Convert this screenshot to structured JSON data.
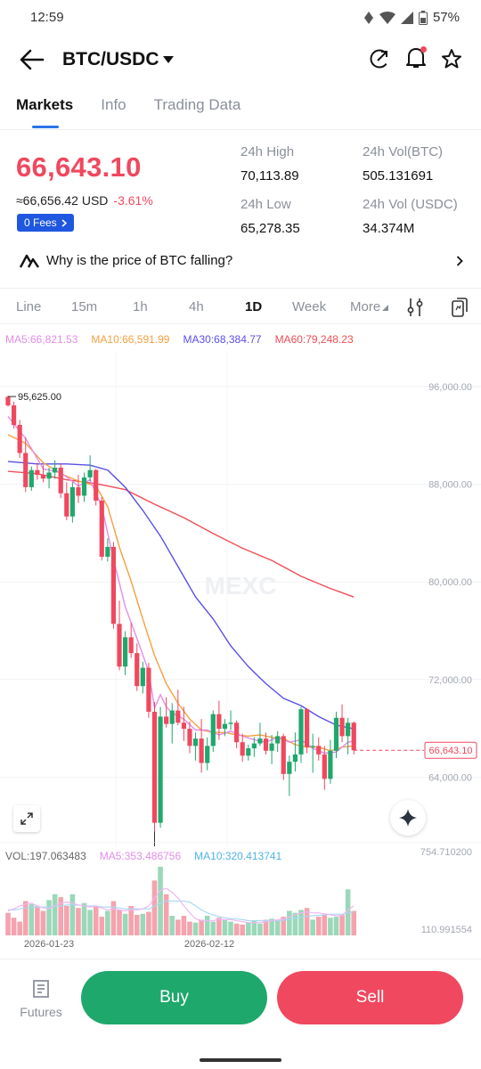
{
  "status": {
    "time": "12:59",
    "battery": "57%"
  },
  "header": {
    "pair": "BTC/USDC"
  },
  "tabs": [
    {
      "label": "Markets"
    },
    {
      "label": "Info"
    },
    {
      "label": "Trading Data"
    }
  ],
  "ticker": {
    "price": "66,643.10",
    "usd_equiv": "≈66,656.42 USD",
    "change": "-3.61%",
    "fees_badge": "0 Fees",
    "high_label": "24h High",
    "high_value": "70,113.89",
    "low_label": "24h Low",
    "low_value": "65,278.35",
    "vol_btc_label": "24h Vol(BTC)",
    "vol_btc_value": "505.131691",
    "vol_usdc_label": "24h Vol (USDC)",
    "vol_usdc_value": "34.374M"
  },
  "insight": {
    "text": "Why is the price of BTC falling?"
  },
  "intervals": [
    {
      "label": "Line"
    },
    {
      "label": "15m"
    },
    {
      "label": "1h"
    },
    {
      "label": "4h"
    },
    {
      "label": "1D",
      "active": true
    },
    {
      "label": "Week"
    },
    {
      "label": "More"
    }
  ],
  "ma": {
    "ma5": "MA5:66,821.53",
    "ma10": "MA10:66,591.99",
    "ma30": "MA30:68,384.77",
    "ma60": "MA60:79,248.23"
  },
  "colors": {
    "up": "#1fa86c",
    "down": "#f0485f",
    "ma5": "#e38ce8",
    "ma10": "#f5a041",
    "ma30": "#5b4fe8",
    "ma60": "#ef4d55",
    "accent": "#2a73e8"
  },
  "watermark": "MEXC",
  "chart_data": {
    "type": "candlestick",
    "interval": "1D",
    "ylim": [
      58000,
      98000
    ],
    "y_ticks": [
      "96,000.00",
      "88,000.00",
      "80,000.00",
      "72,000.00",
      "64,000.00"
    ],
    "last_price_label": "66,643.10",
    "high_marker": "95,625.00",
    "low_marker": "60,000.00",
    "x_labels": [
      "2026-01-23",
      "2026-02-12"
    ],
    "candles": [
      [
        95600,
        95700,
        94800,
        94900
      ],
      [
        94900,
        95200,
        93000,
        93300
      ],
      [
        93300,
        93700,
        90600,
        91000
      ],
      [
        91000,
        92300,
        87800,
        88200
      ],
      [
        88200,
        89900,
        87900,
        89600
      ],
      [
        89600,
        90200,
        88800,
        89200
      ],
      [
        89200,
        90000,
        88600,
        88900
      ],
      [
        88900,
        89800,
        88100,
        89400
      ],
      [
        89400,
        90400,
        88900,
        89800
      ],
      [
        89800,
        90100,
        87300,
        87700
      ],
      [
        87700,
        88600,
        85500,
        85800
      ],
      [
        85800,
        88600,
        85300,
        88200
      ],
      [
        88200,
        89200,
        86900,
        87500
      ],
      [
        87500,
        89400,
        87000,
        89000
      ],
      [
        89000,
        90800,
        88700,
        89600
      ],
      [
        89600,
        89700,
        86700,
        87100
      ],
      [
        87100,
        87400,
        82200,
        82500
      ],
      [
        82500,
        84000,
        82100,
        83300
      ],
      [
        83300,
        83700,
        76600,
        77000
      ],
      [
        77000,
        78900,
        73200,
        73500
      ],
      [
        73500,
        76400,
        72800,
        75900
      ],
      [
        75900,
        77100,
        74200,
        74600
      ],
      [
        74600,
        75400,
        71500,
        71900
      ],
      [
        71900,
        73900,
        71300,
        73400
      ],
      [
        73400,
        73800,
        69300,
        69800
      ],
      [
        69800,
        70600,
        60000,
        60700
      ],
      [
        60700,
        70200,
        60300,
        69400
      ],
      [
        69400,
        71000,
        68500,
        68800
      ],
      [
        68800,
        70500,
        67200,
        69900
      ],
      [
        69900,
        71600,
        68700,
        68900
      ],
      [
        68900,
        70200,
        67400,
        68400
      ],
      [
        68400,
        69000,
        66400,
        67000
      ],
      [
        67000,
        68100,
        65800,
        67600
      ],
      [
        67600,
        69200,
        64800,
        65600
      ],
      [
        65600,
        67700,
        65000,
        67000
      ],
      [
        67000,
        69900,
        66500,
        69600
      ],
      [
        69600,
        70700,
        67500,
        68400
      ],
      [
        68400,
        69200,
        67800,
        68800
      ],
      [
        68800,
        69900,
        68300,
        68900
      ],
      [
        68900,
        69100,
        66800,
        67300
      ],
      [
        67300,
        68000,
        65700,
        66200
      ],
      [
        66200,
        67100,
        65800,
        66800
      ],
      [
        66800,
        67700,
        66100,
        67200
      ],
      [
        67200,
        68900,
        67000,
        67600
      ],
      [
        67600,
        68100,
        66300,
        66600
      ],
      [
        66600,
        67900,
        65500,
        67200
      ],
      [
        67200,
        68200,
        66500,
        67800
      ],
      [
        67800,
        68000,
        64200,
        64700
      ],
      [
        64700,
        66200,
        62900,
        65700
      ],
      [
        65700,
        68100,
        64900,
        66300
      ],
      [
        66300,
        70200,
        65600,
        70000
      ],
      [
        70000,
        70100,
        66400,
        66900
      ],
      [
        66900,
        68000,
        64800,
        67000
      ],
      [
        67000,
        67700,
        65800,
        66300
      ],
      [
        66300,
        67000,
        63400,
        64300
      ],
      [
        64300,
        67500,
        63900,
        66600
      ],
      [
        66600,
        69800,
        66000,
        69300
      ],
      [
        69300,
        70400,
        67300,
        67800
      ],
      [
        67800,
        69300,
        66300,
        68900
      ],
      [
        68900,
        69000,
        66300,
        66643.1
      ]
    ],
    "ma5_points": [
      [
        0,
        94000
      ],
      [
        3,
        92200
      ],
      [
        6,
        89700
      ],
      [
        9,
        89400
      ],
      [
        12,
        88300
      ],
      [
        14,
        88800
      ],
      [
        16,
        86600
      ],
      [
        18,
        82300
      ],
      [
        20,
        78400
      ],
      [
        22,
        75800
      ],
      [
        24,
        73100
      ],
      [
        25,
        70100
      ],
      [
        26,
        71200
      ],
      [
        27,
        70200
      ],
      [
        28,
        69700
      ],
      [
        30,
        69200
      ],
      [
        32,
        68300
      ],
      [
        34,
        68300
      ],
      [
        36,
        67900
      ],
      [
        38,
        68200
      ],
      [
        40,
        67800
      ],
      [
        42,
        67500
      ],
      [
        44,
        67300
      ],
      [
        46,
        67700
      ],
      [
        48,
        67300
      ],
      [
        50,
        67500
      ],
      [
        52,
        66800
      ],
      [
        54,
        66400
      ],
      [
        56,
        66500
      ],
      [
        58,
        67300
      ],
      [
        59,
        67400
      ]
    ],
    "ma10_points": [
      [
        0,
        92500
      ],
      [
        3,
        91800
      ],
      [
        6,
        90200
      ],
      [
        9,
        89300
      ],
      [
        12,
        88700
      ],
      [
        15,
        88300
      ],
      [
        17,
        86600
      ],
      [
        19,
        83300
      ],
      [
        21,
        80500
      ],
      [
        23,
        77400
      ],
      [
        25,
        74400
      ],
      [
        27,
        72100
      ],
      [
        29,
        70500
      ],
      [
        31,
        69200
      ],
      [
        33,
        68300
      ],
      [
        35,
        68100
      ],
      [
        37,
        68100
      ],
      [
        39,
        67900
      ],
      [
        41,
        67800
      ],
      [
        43,
        67900
      ],
      [
        45,
        67700
      ],
      [
        47,
        67600
      ],
      [
        49,
        67100
      ],
      [
        51,
        66900
      ],
      [
        53,
        66900
      ],
      [
        55,
        66600
      ],
      [
        57,
        66900
      ],
      [
        59,
        67000
      ]
    ],
    "ma30_points": [
      [
        0,
        90300
      ],
      [
        5,
        90100
      ],
      [
        10,
        90100
      ],
      [
        14,
        90000
      ],
      [
        17,
        89600
      ],
      [
        20,
        88200
      ],
      [
        23,
        86300
      ],
      [
        26,
        84200
      ],
      [
        29,
        81700
      ],
      [
        32,
        79200
      ],
      [
        35,
        77400
      ],
      [
        38,
        75200
      ],
      [
        41,
        73500
      ],
      [
        44,
        72100
      ],
      [
        47,
        70900
      ],
      [
        50,
        70300
      ],
      [
        53,
        69400
      ],
      [
        56,
        68700
      ],
      [
        59,
        68400
      ]
    ],
    "ma60_points": [
      [
        0,
        89500
      ],
      [
        5,
        89300
      ],
      [
        10,
        88800
      ],
      [
        15,
        88500
      ],
      [
        20,
        88000
      ],
      [
        25,
        86800
      ],
      [
        30,
        85700
      ],
      [
        35,
        84400
      ],
      [
        40,
        83200
      ],
      [
        45,
        82200
      ],
      [
        50,
        80900
      ],
      [
        55,
        79900
      ],
      [
        59,
        79200
      ]
    ],
    "volume": {
      "vol_label": "VOL:197.063483",
      "ma5_label": "MA5:353.486756",
      "ma10_label": "MA10:320.413741",
      "max_label": "754.710200",
      "min_label": "110.991554",
      "values": [
        230,
        180,
        140,
        350,
        320,
        300,
        250,
        360,
        420,
        390,
        300,
        420,
        280,
        330,
        260,
        300,
        190,
        250,
        350,
        260,
        220,
        300,
        210,
        220,
        240,
        560,
        700,
        420,
        200,
        160,
        200,
        140,
        130,
        160,
        200,
        140,
        180,
        160,
        140,
        120,
        110,
        130,
        150,
        120,
        160,
        170,
        150,
        190,
        250,
        230,
        260,
        280,
        160,
        190,
        210,
        180,
        190,
        210,
        470,
        250
      ],
      "ma5_values": [
        250,
        270,
        300,
        320,
        330,
        300,
        280,
        270,
        300,
        330,
        340,
        330,
        310,
        300,
        290,
        300,
        280,
        260,
        270,
        260,
        250,
        260,
        260,
        270,
        300,
        380,
        460,
        480,
        440,
        380,
        300,
        230,
        170,
        150,
        150,
        150,
        160,
        160,
        160,
        150,
        140,
        130,
        130,
        130,
        140,
        150,
        160,
        170,
        190,
        210,
        230,
        240,
        230,
        230,
        220,
        210,
        200,
        200,
        260,
        300
      ],
      "ma10_values": [
        260,
        260,
        270,
        280,
        290,
        290,
        290,
        290,
        300,
        300,
        310,
        310,
        310,
        300,
        300,
        300,
        290,
        290,
        290,
        280,
        270,
        270,
        270,
        270,
        270,
        300,
        330,
        350,
        350,
        350,
        350,
        340,
        300,
        260,
        230,
        210,
        190,
        180,
        170,
        170,
        160,
        150,
        150,
        150,
        150,
        150,
        150,
        155,
        165,
        175,
        185,
        195,
        200,
        205,
        210,
        215,
        215,
        215,
        230,
        240
      ]
    }
  }
}
